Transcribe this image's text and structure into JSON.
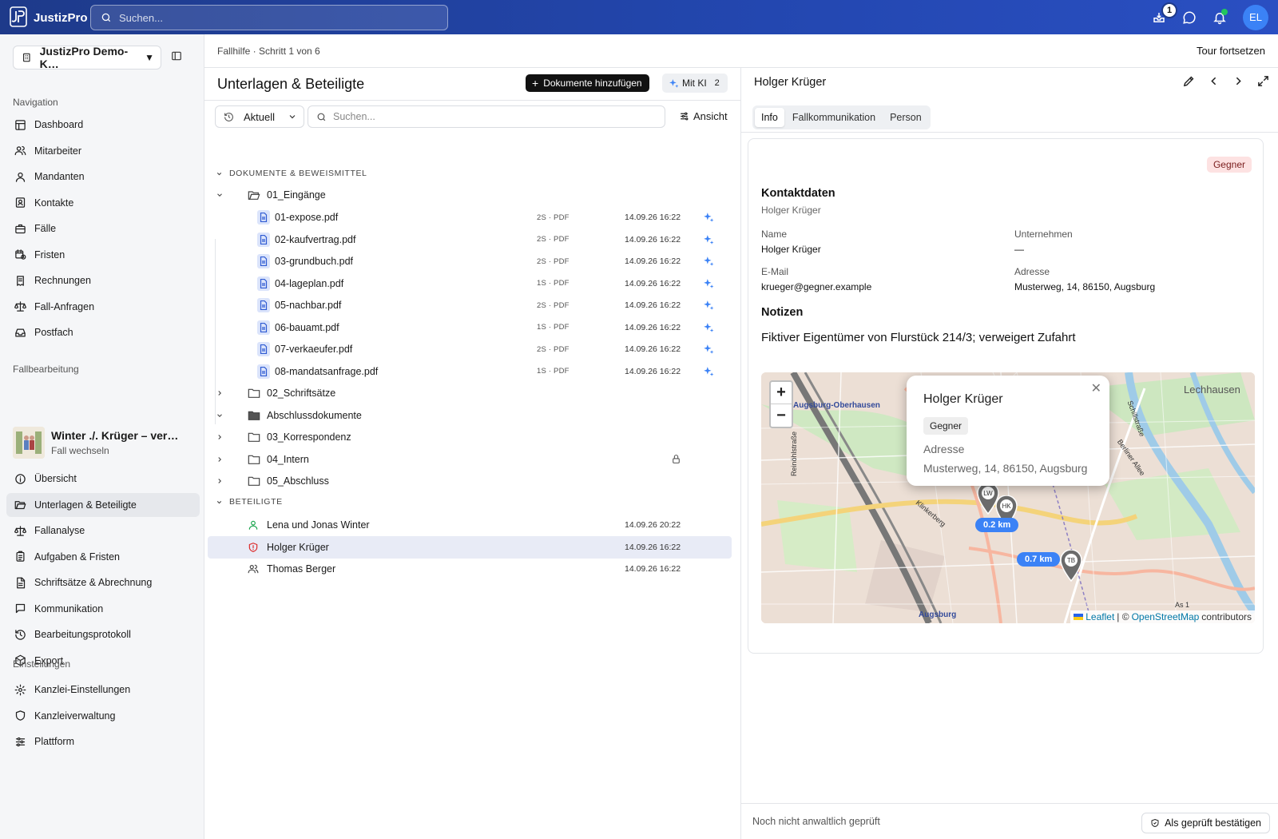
{
  "app": {
    "name": "JustizPro",
    "search_placeholder": "Suchen...",
    "notification_count": "1",
    "avatar_initials": "EL"
  },
  "sidebar": {
    "kanzlei": "JustizPro Demo-K…",
    "sections": {
      "navigation": "Navigation",
      "fallbearbeitung": "Fallbearbeitung",
      "einstellungen": "Einstellungen"
    },
    "nav_items": [
      {
        "label": "Dashboard",
        "icon": "dashboard-icon"
      },
      {
        "label": "Mitarbeiter",
        "icon": "users-icon"
      },
      {
        "label": "Mandanten",
        "icon": "user-icon"
      },
      {
        "label": "Kontakte",
        "icon": "contacts-icon"
      },
      {
        "label": "Fälle",
        "icon": "briefcase-icon"
      },
      {
        "label": "Fristen",
        "icon": "calendar-clock-icon"
      },
      {
        "label": "Rechnungen",
        "icon": "receipt-icon"
      },
      {
        "label": "Fall-Anfragen",
        "icon": "scale-icon"
      },
      {
        "label": "Postfach",
        "icon": "inbox-icon"
      }
    ],
    "case": {
      "title": "Winter ./. Krüger – verw…",
      "switch_label": "Fall wechseln"
    },
    "case_items": [
      {
        "label": "Übersicht",
        "icon": "info-icon"
      },
      {
        "label": "Unterlagen & Beteiligte",
        "icon": "folder-open-icon",
        "active": true
      },
      {
        "label": "Fallanalyse",
        "icon": "scale-icon"
      },
      {
        "label": "Aufgaben & Fristen",
        "icon": "clipboard-icon"
      },
      {
        "label": "Schriftsätze & Abrechnung",
        "icon": "file-text-icon"
      },
      {
        "label": "Kommunikation",
        "icon": "message-icon"
      },
      {
        "label": "Bearbeitungsprotokoll",
        "icon": "history-icon"
      },
      {
        "label": "Export",
        "icon": "package-icon"
      }
    ],
    "settings_items": [
      {
        "label": "Kanzlei-Einstellungen",
        "icon": "gear-icon"
      },
      {
        "label": "Kanzleiverwaltung",
        "icon": "shield-icon"
      },
      {
        "label": "Plattform",
        "icon": "sliders-icon"
      }
    ]
  },
  "header": {
    "breadcrumb": "Fallhilfe · Schritt 1 von 6",
    "tour": "Tour fortsetzen"
  },
  "left": {
    "title": "Unterlagen & Beteiligte",
    "add_docs": "Dokumente hinzufügen",
    "ki_label": "Mit KI",
    "ki_count": "2",
    "filter": "Aktuell",
    "search_placeholder": "Suchen...",
    "view": "Ansicht",
    "group_docs": "DOKUMENTE & BEWEISMITTEL",
    "group_parties": "BETEILIGTE",
    "folder_open": "01_Eingänge",
    "files": [
      {
        "name": "01-expose.pdf",
        "meta": "2S · PDF",
        "date": "14.09.26 16:22"
      },
      {
        "name": "02-kaufvertrag.pdf",
        "meta": "2S · PDF",
        "date": "14.09.26 16:22"
      },
      {
        "name": "03-grundbuch.pdf",
        "meta": "2S · PDF",
        "date": "14.09.26 16:22"
      },
      {
        "name": "04-lageplan.pdf",
        "meta": "1S · PDF",
        "date": "14.09.26 16:22"
      },
      {
        "name": "05-nachbar.pdf",
        "meta": "2S · PDF",
        "date": "14.09.26 16:22"
      },
      {
        "name": "06-bauamt.pdf",
        "meta": "1S · PDF",
        "date": "14.09.26 16:22"
      },
      {
        "name": "07-verkaeufer.pdf",
        "meta": "2S · PDF",
        "date": "14.09.26 16:22"
      },
      {
        "name": "08-mandatsanfrage.pdf",
        "meta": "1S · PDF",
        "date": "14.09.26 16:22"
      }
    ],
    "folders": [
      {
        "name": "02_Schriftsätze",
        "filled": false,
        "expanded": false,
        "locked": false
      },
      {
        "name": "Abschlussdokumente",
        "filled": true,
        "expanded": true,
        "locked": false
      },
      {
        "name": "03_Korrespondenz",
        "filled": false,
        "expanded": false,
        "locked": false
      },
      {
        "name": "04_Intern",
        "filled": false,
        "expanded": false,
        "locked": true
      },
      {
        "name": "05_Abschluss",
        "filled": false,
        "expanded": false,
        "locked": false
      }
    ],
    "parties": [
      {
        "name": "Lena und Jonas Winter",
        "date": "14.09.26 20:22",
        "icon": "user-icon",
        "color": "#16a34a"
      },
      {
        "name": "Holger Krüger",
        "date": "14.09.26 16:22",
        "icon": "shield-alert-icon",
        "color": "#dc2626",
        "selected": true
      },
      {
        "name": "Thomas Berger",
        "date": "14.09.26 16:22",
        "icon": "users-icon",
        "color": "#444444"
      }
    ]
  },
  "right": {
    "title": "Holger Krüger",
    "tabs": [
      "Info",
      "Fallkommunikation",
      "Person"
    ],
    "role_badge": "Gegner",
    "contact_heading": "Kontaktdaten",
    "contact_sub": "Holger Krüger",
    "fields": {
      "name_label": "Name",
      "name_value": "Holger Krüger",
      "company_label": "Unternehmen",
      "company_value": "—",
      "email_label": "E-Mail",
      "email_value": "krueger@gegner.example",
      "address_label": "Adresse",
      "address_value": "Musterweg, 14, 86150, Augsburg"
    },
    "notes_heading": "Notizen",
    "notes_text": "Fiktiver Eigentümer von Flurstück 214/3; verweigert Zufahrt",
    "map": {
      "popup_name": "Holger Krüger",
      "popup_badge": "Gegner",
      "popup_address_label": "Adresse",
      "popup_address": "Musterweg, 14, 86150, Augsburg",
      "distance_1": "0.2 km",
      "distance_2": "0.7 km",
      "markers": [
        "LW",
        "HK",
        "TB"
      ],
      "labels": {
        "oberhausen": "Augsburg-Oberhausen",
        "lechhausen": "Lechhausen",
        "augsburg": "Augsburg",
        "schillstrasse": "Schillstraße",
        "berliner": "Berliner Allee",
        "reinoehl": "Reinöhlstraße",
        "klinkerberg": "Klinkerberg",
        "autobahn": "As 1"
      },
      "attribution_leaflet": "Leaflet",
      "attribution_sep": "| ©",
      "attribution_osm": "OpenStreetMap",
      "attribution_contrib": "contributors"
    },
    "footer_status": "Noch nicht anwaltlich geprüft",
    "confirm": "Als geprüft bestätigen"
  },
  "colors": {
    "topbar": "#1e3a8a",
    "accent": "#3b82f6",
    "selected_row": "#e8ebf6",
    "gegner_badge": "#fde2e2"
  }
}
